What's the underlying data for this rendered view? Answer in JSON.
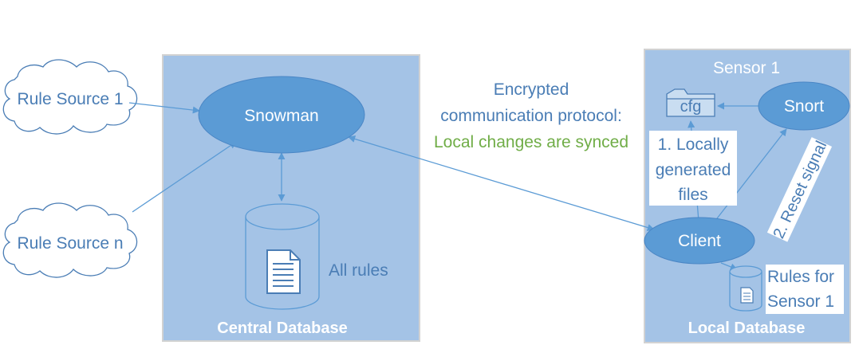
{
  "colors": {
    "panel_fill": "#a4c3e6",
    "panel_stroke": "#d2d2d2",
    "node_fill": "#5b9bd5",
    "node_text": "#ffffff",
    "label_text": "#4a7db5",
    "highlight_text": "#70ad47",
    "arrow": "#5b9bd5",
    "cloud_stroke": "#4a7db5"
  },
  "sources": {
    "source1": "Rule Source 1",
    "sourceN": "Rule Source n"
  },
  "central": {
    "snowman": "Snowman",
    "all_rules": "All rules",
    "panel_label": "Central Database"
  },
  "protocol": {
    "line1": "Encrypted",
    "line2": "communication protocol:",
    "line3": "Local changes are synced"
  },
  "sensor": {
    "title": "Sensor 1",
    "cfg": "cfg",
    "snort": "Snort",
    "client": "Client",
    "generated_line1": "1. Locally",
    "generated_line2": "generated",
    "generated_line3": "files",
    "reset_signal": "2. Reset signal",
    "rules_line1": "Rules for",
    "rules_line2": "Sensor 1",
    "panel_label": "Local Database"
  },
  "icons": {
    "cloud1": "cloud-icon",
    "cloudN": "cloud-icon",
    "central_db": "database-cylinder-icon",
    "document": "document-icon",
    "folder": "folder-icon",
    "local_db": "database-cylinder-icon"
  }
}
